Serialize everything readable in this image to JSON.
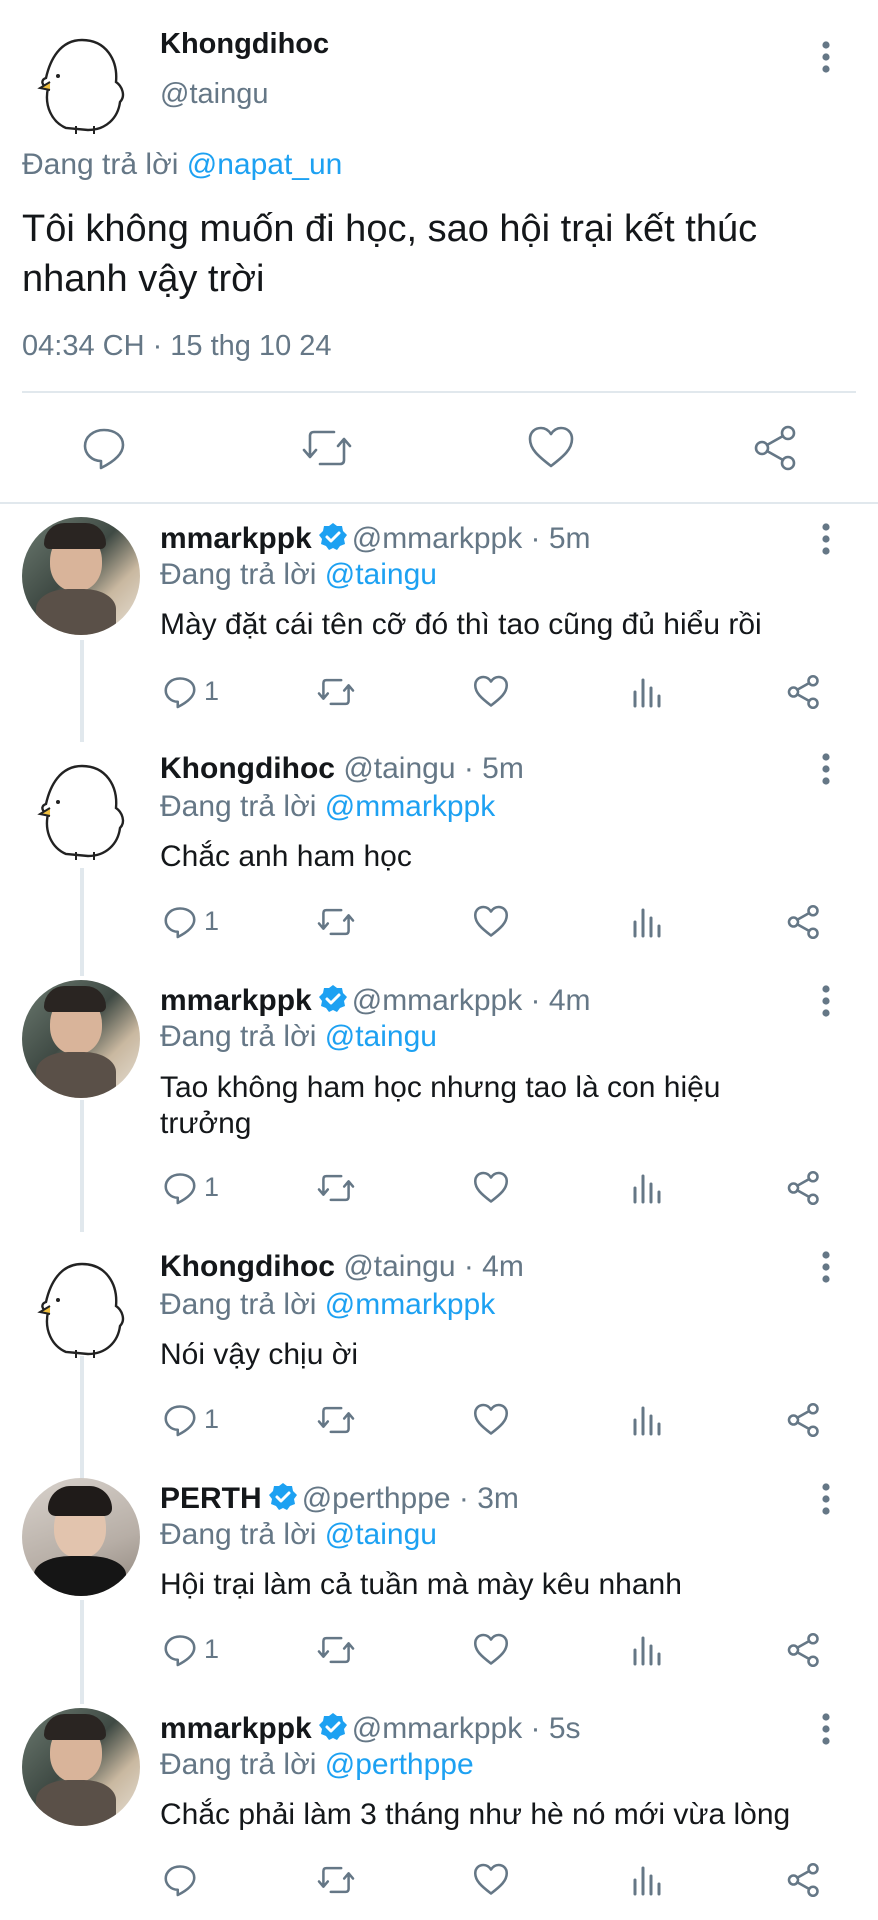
{
  "main": {
    "display_name": "Khongdihoc",
    "handle": "@taingu",
    "replying_prefix": "Đang trả lời",
    "replying_to": "@napat_un",
    "text_line1": "Tôi không muốn đi học, sao hội trại kết thúc",
    "text_line2": "nhanh vậy trời",
    "timestamp": "04:34 CH · 15 thg 10 24"
  },
  "replies": [
    {
      "name": "mmarkppk",
      "verified": true,
      "handle": "@mmarkppk · 5m",
      "prefix": "Đang trả lời",
      "to": "@taingu",
      "line1": "Mày đặt cái tên cỡ đó thì tao cũng đủ hiểu rồi",
      "line2": "",
      "reply_count": "1"
    },
    {
      "name": "Khongdihoc",
      "verified": false,
      "handle": "@taingu · 5m",
      "prefix": "Đang trả lời",
      "to": "@mmarkppk",
      "line1": "Chắc anh ham học",
      "line2": "",
      "reply_count": "1"
    },
    {
      "name": "mmarkppk",
      "verified": true,
      "handle": "@mmarkppk · 4m",
      "prefix": "Đang trả lời",
      "to": "@taingu",
      "line1": "Tao không ham học nhưng tao là con hiệu",
      "line2": "trưởng",
      "reply_count": "1"
    },
    {
      "name": "Khongdihoc",
      "verified": false,
      "handle": "@taingu · 4m",
      "prefix": "Đang trả lời",
      "to": "@mmarkppk",
      "line1": "Nói vậy chịu ời",
      "line2": "",
      "reply_count": "1"
    },
    {
      "name": "PERTH",
      "verified": true,
      "handle": "@perthppe · 3m",
      "prefix": "Đang trả lời",
      "to": "@taingu",
      "line1": "Hội trại làm cả tuần mà mày kêu nhanh",
      "line2": "",
      "reply_count": "1"
    },
    {
      "name": "mmarkppk",
      "verified": true,
      "handle": "@mmarkppk · 5s",
      "prefix": "Đang trả lời",
      "to": "@perthppe",
      "line1": "Chắc phải làm 3 tháng như hè nó mới vừa lòng",
      "line2": "",
      "reply_count": ""
    }
  ],
  "colors": {
    "link": "#1da1f2",
    "muted": "#657786",
    "divider": "#e1e8ed",
    "verified": "#1da1f2"
  }
}
